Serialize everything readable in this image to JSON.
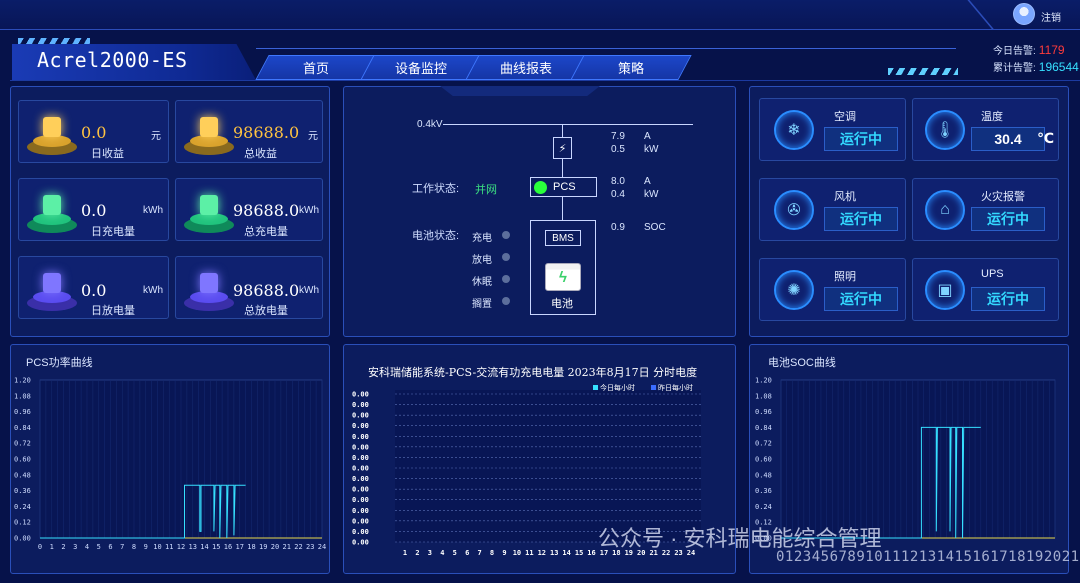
{
  "header": {
    "app_title": "Acrel2000-ES",
    "logout": "注销",
    "nav": [
      "首页",
      "设备监控",
      "曲线报表",
      "策略"
    ],
    "alarms": {
      "today_label": "今日告警:",
      "today_value": "1179",
      "total_label": "累计告警:",
      "total_value": "196544"
    }
  },
  "stats": [
    {
      "value": "0.0",
      "unit": "元",
      "label": "日收益",
      "icon": "coin-icon"
    },
    {
      "value": "98688.0",
      "unit": "元",
      "label": "总收益",
      "icon": "coin-icon"
    },
    {
      "value": "0.0",
      "unit": "kWh",
      "label": "日充电量",
      "icon": "battery-charge-icon"
    },
    {
      "value": "98688.0",
      "unit": "kWh",
      "label": "总充电量",
      "icon": "battery-charge-icon"
    },
    {
      "value": "0.0",
      "unit": "kWh",
      "label": "日放电量",
      "icon": "battery-discharge-icon"
    },
    {
      "value": "98688.0",
      "unit": "kWh",
      "label": "总放电量",
      "icon": "battery-discharge-icon"
    }
  ],
  "topology": {
    "bus_label": "0.4kV",
    "meter": {
      "current": "7.9",
      "current_unit": "A",
      "power": "0.5",
      "power_unit": "kW"
    },
    "pcs_reading": {
      "current": "8.0",
      "current_unit": "A",
      "power": "0.4",
      "power_unit": "kW"
    },
    "soc_reading": {
      "value": "0.9",
      "unit": "SOC"
    },
    "work_state_label": "工作状态:",
    "work_state_value": "并网",
    "pcs_label": "PCS",
    "battery_state_label": "电池状态:",
    "battery_states": [
      "充电",
      "放电",
      "休眠",
      "搁置"
    ],
    "bms_label": "BMS",
    "battery_label": "电池"
  },
  "devices": [
    {
      "name": "空调",
      "status": "运行中",
      "icon": "air-conditioner-icon"
    },
    {
      "name": "温度",
      "status": "30.4",
      "unit": "℃",
      "icon": "thermometer-icon"
    },
    {
      "name": "风机",
      "status": "运行中",
      "icon": "fan-icon"
    },
    {
      "name": "火灾报警",
      "status": "运行中",
      "icon": "fire-alarm-icon"
    },
    {
      "name": "照明",
      "status": "运行中",
      "icon": "light-bulb-icon"
    },
    {
      "name": "UPS",
      "status": "运行中",
      "icon": "ups-icon"
    }
  ],
  "watermark": {
    "text": "公众号 · 安科瑞电能综合管理",
    "numbers": "0123456789101112131415161718192021222324"
  },
  "chart_data": [
    {
      "id": "pcs",
      "type": "line",
      "title": "PCS功率曲线",
      "x_ticks": [
        "0",
        "1",
        "2",
        "3",
        "4",
        "5",
        "6",
        "7",
        "8",
        "9",
        "10",
        "11",
        "12",
        "13",
        "14",
        "15",
        "16",
        "17",
        "18",
        "19",
        "20",
        "21",
        "22",
        "23",
        "24"
      ],
      "y_ticks": [
        "1.20",
        "1.08",
        "0.96",
        "0.84",
        "0.72",
        "0.60",
        "0.48",
        "0.36",
        "0.24",
        "0.12",
        "0.00"
      ],
      "ylim": [
        0,
        1.2
      ],
      "xlim": [
        0,
        24
      ],
      "series": [
        {
          "color": "#e8d84a",
          "points": [
            [
              0,
              0
            ],
            [
              24,
              0
            ]
          ]
        },
        {
          "color": "#36e0ff",
          "points": [
            [
              0,
              0
            ],
            [
              12.3,
              0
            ],
            [
              12.3,
              0.4
            ],
            [
              13.6,
              0.4
            ],
            [
              13.6,
              0.05
            ],
            [
              13.7,
              0.05
            ],
            [
              13.7,
              0.4
            ],
            [
              14.8,
              0.4
            ],
            [
              14.8,
              0.05
            ],
            [
              14.9,
              0.4
            ],
            [
              15.3,
              0.4
            ],
            [
              15.3,
              0.0
            ],
            [
              15.4,
              0.4
            ],
            [
              15.9,
              0.4
            ],
            [
              15.9,
              0.0
            ],
            [
              16.0,
              0.4
            ],
            [
              16.5,
              0.4
            ],
            [
              16.5,
              0.02
            ],
            [
              16.6,
              0.4
            ],
            [
              17.5,
              0.4
            ]
          ]
        }
      ]
    },
    {
      "id": "energy",
      "type": "bar",
      "title": "安科瑞储能系统-PCS-交流有功充电电量  2023年8月17日  分时电度",
      "legend": [
        "今日每小时",
        "昨日每小时"
      ],
      "legend_colors": [
        "#36e0ff",
        "#3a6cff"
      ],
      "categories": [
        "1",
        "2",
        "3",
        "4",
        "5",
        "6",
        "7",
        "8",
        "9",
        "10",
        "11",
        "12",
        "13",
        "14",
        "15",
        "16",
        "17",
        "18",
        "19",
        "20",
        "21",
        "22",
        "23",
        "24"
      ],
      "y_ticks": [
        "0.00",
        "0.00",
        "0.00",
        "0.00",
        "0.00",
        "0.00",
        "0.00",
        "0.00",
        "0.00",
        "0.00",
        "0.00",
        "0.00",
        "0.00",
        "0.00",
        "0.00"
      ],
      "series": [
        {
          "name": "今日每小时",
          "values": [
            0,
            0,
            0,
            0,
            0,
            0,
            0,
            0,
            0,
            0,
            0,
            0,
            0,
            0,
            0,
            0,
            0,
            0,
            0,
            0,
            0,
            0,
            0,
            0
          ]
        },
        {
          "name": "昨日每小时",
          "values": [
            0,
            0,
            0,
            0,
            0,
            0,
            0,
            0,
            0,
            0,
            0,
            0,
            0,
            0,
            0,
            0,
            0,
            0,
            0,
            0,
            0,
            0,
            0,
            0
          ]
        }
      ]
    },
    {
      "id": "soc",
      "type": "line",
      "title": "电池SOC曲线",
      "y_ticks": [
        "1.20",
        "1.08",
        "0.96",
        "0.84",
        "0.72",
        "0.60",
        "0.48",
        "0.36",
        "0.24",
        "0.12",
        "0.00"
      ],
      "ylim": [
        0,
        1.2
      ],
      "xlim": [
        0,
        24
      ],
      "series": [
        {
          "color": "#e8d84a",
          "points": [
            [
              0,
              0
            ],
            [
              24,
              0
            ]
          ]
        },
        {
          "color": "#36e0ff",
          "points": [
            [
              0,
              0
            ],
            [
              12.3,
              0
            ],
            [
              12.3,
              0.84
            ],
            [
              13.6,
              0.84
            ],
            [
              13.6,
              0.05
            ],
            [
              13.7,
              0.84
            ],
            [
              14.8,
              0.84
            ],
            [
              14.8,
              0.05
            ],
            [
              14.9,
              0.84
            ],
            [
              15.3,
              0.84
            ],
            [
              15.3,
              0.0
            ],
            [
              15.4,
              0.84
            ],
            [
              15.9,
              0.84
            ],
            [
              15.9,
              0.0
            ],
            [
              16.0,
              0.84
            ],
            [
              17.5,
              0.84
            ]
          ]
        }
      ]
    }
  ]
}
